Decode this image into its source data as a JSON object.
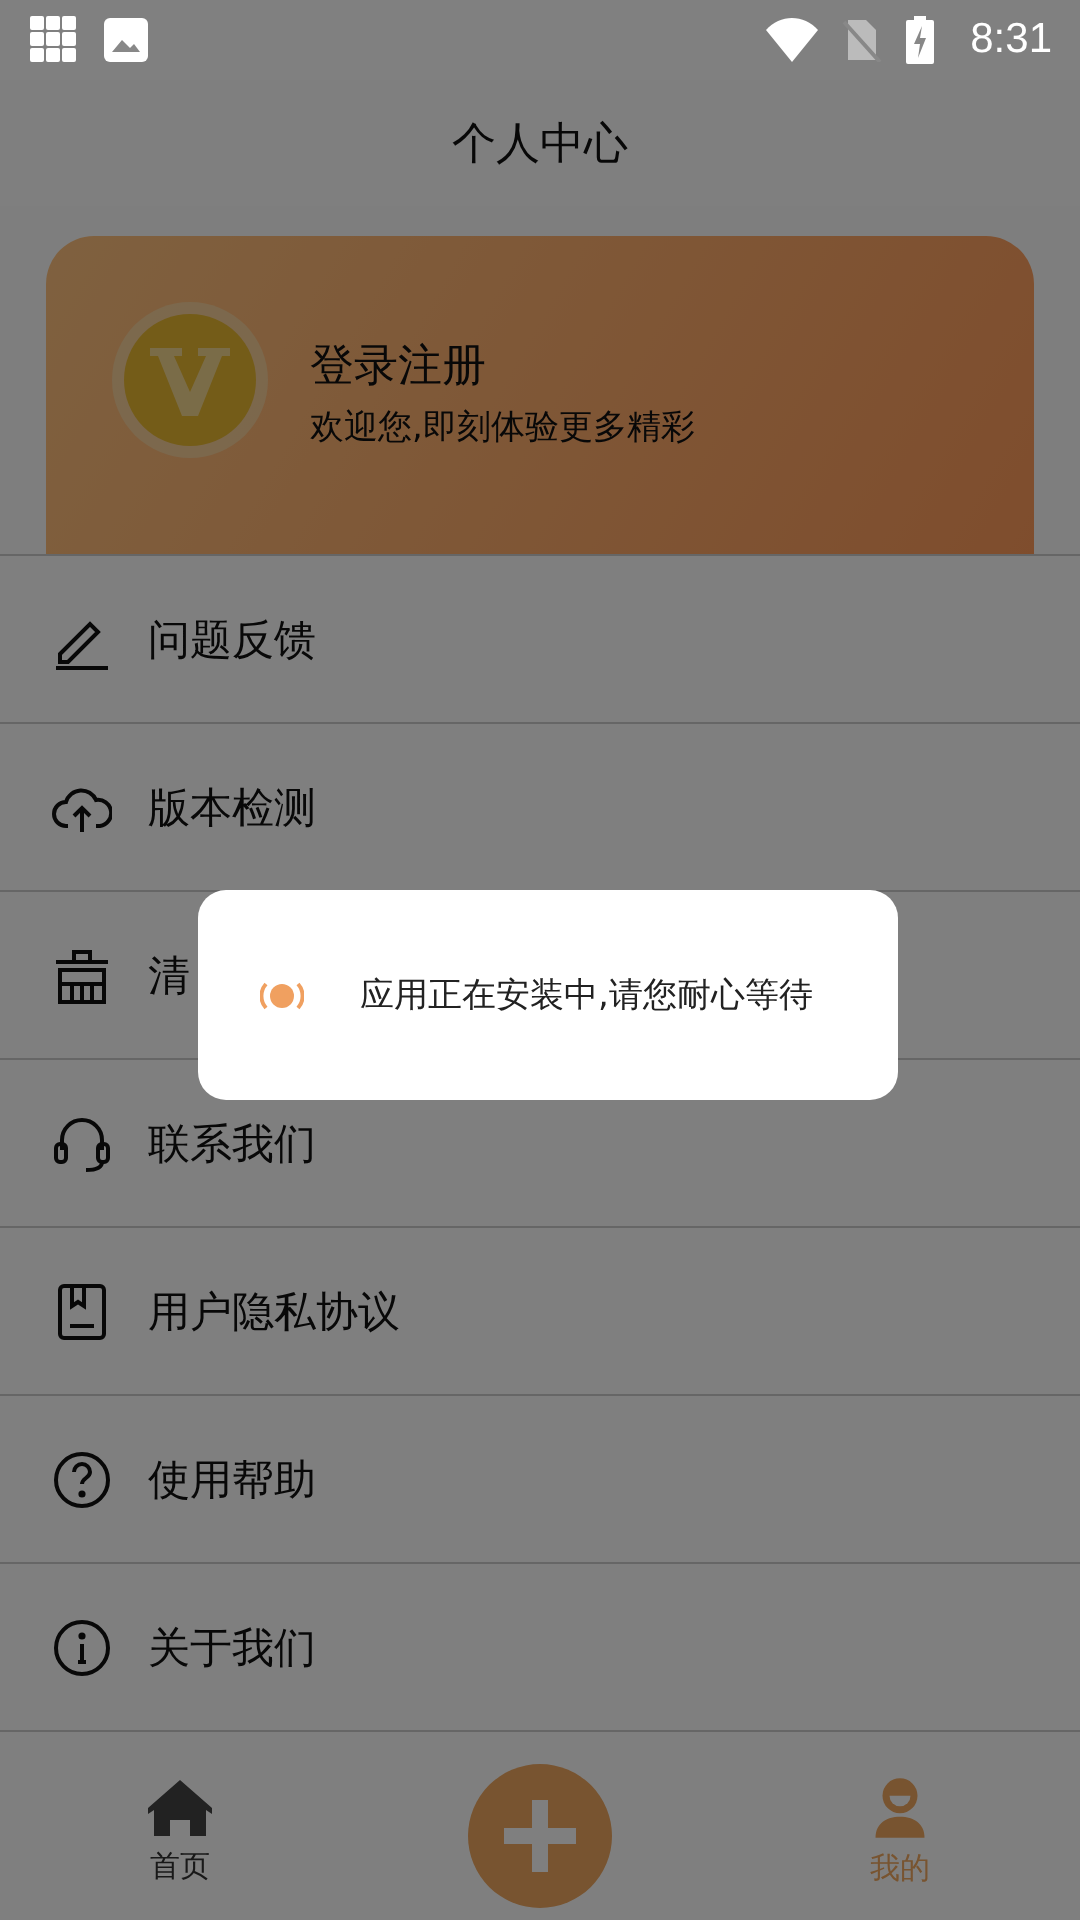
{
  "status_bar": {
    "time": "8:31"
  },
  "title": "个人中心",
  "profile": {
    "name": "登录注册",
    "subtitle": "欢迎您,即刻体验更多精彩"
  },
  "menu": [
    {
      "kind": "edit",
      "label": "问题反馈"
    },
    {
      "kind": "cloud",
      "label": "版本检测"
    },
    {
      "kind": "basket",
      "label": "清"
    },
    {
      "kind": "headset",
      "label": "联系我们"
    },
    {
      "kind": "document",
      "label": "用户隐私协议"
    },
    {
      "kind": "help",
      "label": "使用帮助"
    },
    {
      "kind": "info",
      "label": "关于我们"
    }
  ],
  "tabs": [
    {
      "kind": "home",
      "label": "首页",
      "selected": false
    },
    {
      "kind": "add"
    },
    {
      "kind": "profile",
      "label": "我的",
      "selected": true
    }
  ],
  "dialog": {
    "message": "应用正在安装中,请您耐心等待"
  }
}
